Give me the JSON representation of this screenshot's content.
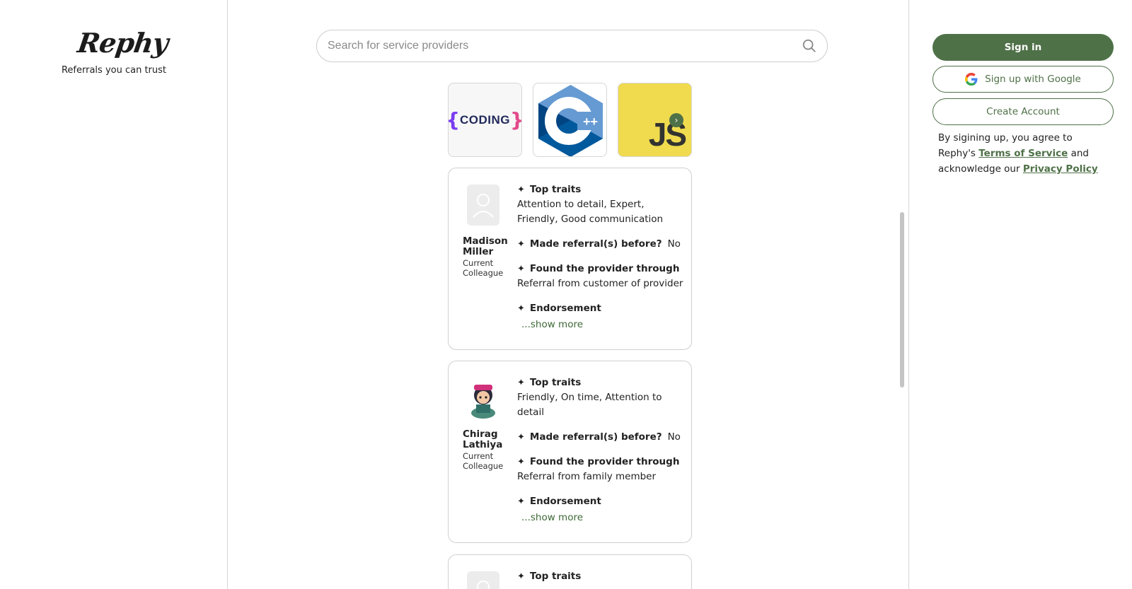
{
  "brand": {
    "logo": "Rephy",
    "tagline": "Referrals you can trust"
  },
  "search": {
    "placeholder": "Search for service providers",
    "icon": "search-icon"
  },
  "skills": [
    {
      "name": "coding",
      "label": "CODING"
    },
    {
      "name": "cpp",
      "label": "C++"
    },
    {
      "name": "javascript",
      "label": "JS"
    }
  ],
  "section_labels": {
    "top_traits": "Top traits",
    "made_referral": "Made referral(s) before?",
    "found_through": "Found the provider through",
    "endorsement": "Endorsement",
    "show_more": "...show more"
  },
  "referrals": [
    {
      "name": "Madison Miller",
      "relation": "Current Colleague",
      "traits": "Attention to detail, Expert, Friendly, Good communication",
      "made_referral": "No",
      "found_through": "Referral from customer of provider"
    },
    {
      "name": "Chirag Lathiya",
      "relation": "Current Colleague",
      "traits": "Friendly, On time, Attention to detail",
      "made_referral": "No",
      "found_through": "Referral from family member"
    }
  ],
  "auth": {
    "signin": "Sign in",
    "google": "Sign up with Google",
    "create": "Create Account",
    "terms_prefix": "By sigining up, you agree to Rephy's",
    "terms_link": "Terms of Service",
    "terms_middle": "and acknowledge our",
    "privacy_link": "Privacy Policy"
  },
  "colors": {
    "accent": "#4f7148",
    "js_yellow": "#f0db4f",
    "cpp_blue": "#00599c"
  }
}
